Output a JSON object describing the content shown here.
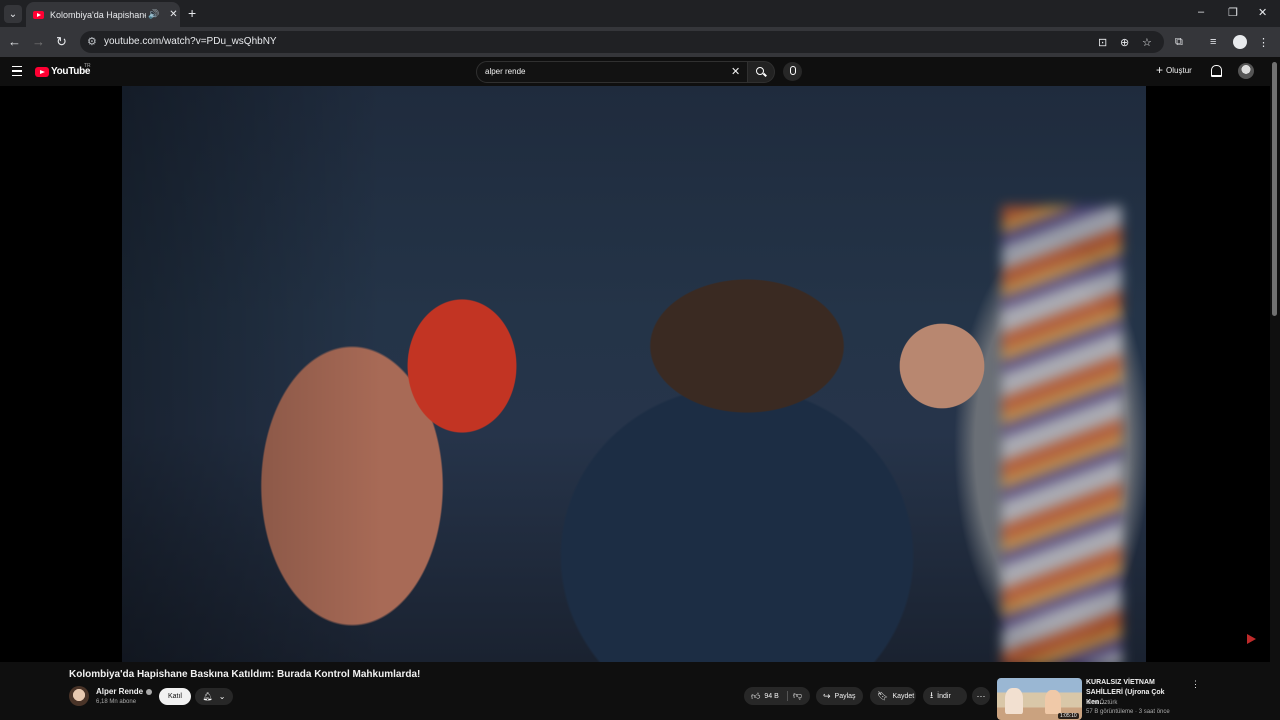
{
  "browser": {
    "tab_title": "Kolombiya'da Hapishane B",
    "url": "youtube.com/watch?v=PDu_wsQhbNY",
    "window_controls": [
      "–",
      "▢",
      "✕"
    ]
  },
  "youtube": {
    "logo_text": "YouTube",
    "country_code": "TR",
    "search_query": "alper rende",
    "create_label": "Oluştur"
  },
  "video": {
    "title": "Kolombiya'da Hapishane Baskına Katıldım: Burada Kontrol Mahkumlarda!",
    "channel_name": "Alper Rende",
    "subscribers": "6,18 Mn abone",
    "join_label": "Katıl",
    "likes": "94 B",
    "share_label": "Paylaş",
    "save_label": "Kaydet",
    "download_label": "İndir"
  },
  "recommendation": {
    "title": "KURALSIZ VİETNAM SAHİLLERİ (Ujrona Çok Ken…",
    "channel": "Mert Öztürk",
    "meta": "57 B görüntüleme · 3 saat önce",
    "duration": "1:05:10"
  },
  "colors": {
    "youtube_red": "#ff0033",
    "page_bg": "#0f0f0f",
    "chrome_bg": "#202124"
  }
}
